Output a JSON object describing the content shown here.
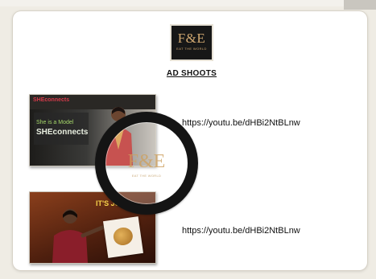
{
  "logo": {
    "text": "F&E",
    "subtext": "EAT THE WORLD"
  },
  "section": {
    "heading": "AD SHOOTS"
  },
  "videos": [
    {
      "brand": "SHEconnects",
      "caption_line1": "She is a Model",
      "caption_line2": "SHEconnects",
      "link": "https://youtu.be/dHBi2NtBLnw"
    },
    {
      "caption": "IT'S JU...",
      "link": "https://youtu.be/dHBi2NtBLnw"
    }
  ],
  "watermark": {
    "text": "F&E",
    "subtext": "EAT THE WORLD"
  },
  "colors": {
    "gold": "#cfa770",
    "accent_red": "#d63a4a",
    "caption_green": "#a6d86a",
    "yellow": "#f5d14a"
  }
}
